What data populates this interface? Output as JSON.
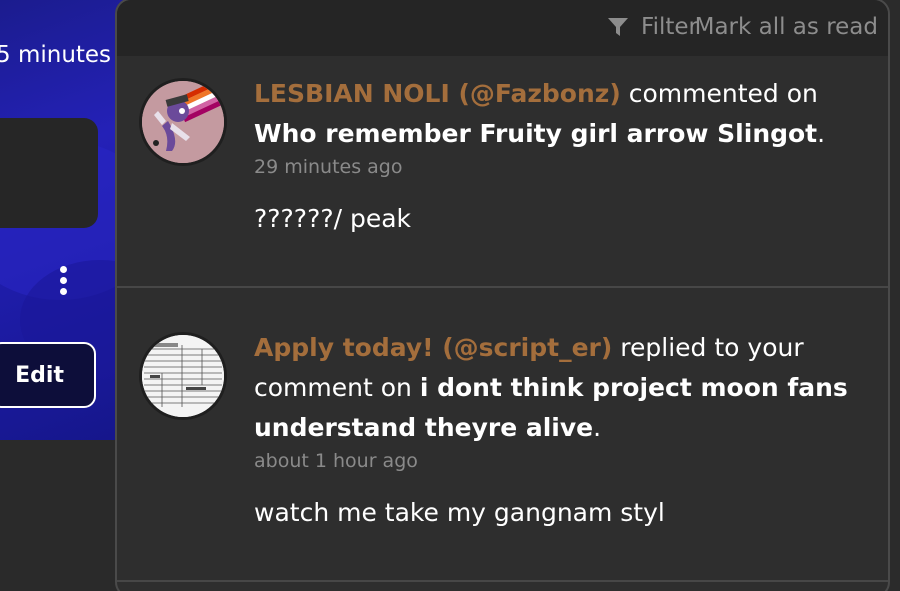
{
  "background": {
    "time_fragment": "5 minutes",
    "edit_label": "Edit"
  },
  "header": {
    "filter_label": "Filter",
    "mark_all_label": "Mark all as read"
  },
  "notifications": [
    {
      "user": "LESBIAN NOLI (@Fazbonz)",
      "action": "commented on",
      "target": "Who remember Fruity girl arrow Slingot",
      "punct": ".",
      "time": "29 minutes ago",
      "body": "??????/ peak"
    },
    {
      "user": "Apply today! (@script_er)",
      "action": "replied to your comment on",
      "target": "i dont think project moon fans understand theyre alive",
      "punct": ".",
      "time": "about 1 hour ago",
      "body": "watch me take my gangnam styl"
    }
  ],
  "colors": {
    "username": "#a46e3c",
    "panel_bg": "#2e2e2e",
    "header_bg": "#252525",
    "muted_text": "#8a8a8a"
  },
  "icons": {
    "filter": "filter-funnel-icon",
    "menu": "kebab-menu-icon"
  }
}
